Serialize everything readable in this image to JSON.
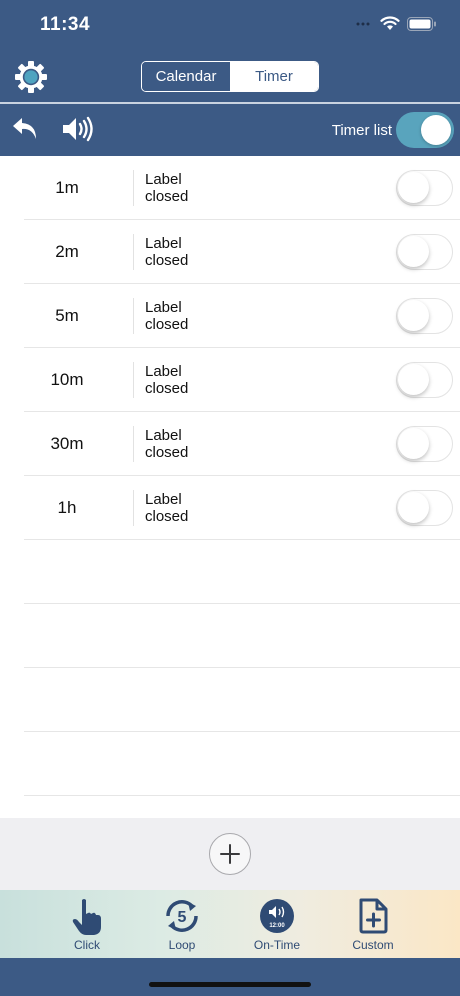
{
  "status_bar": {
    "time": "11:34"
  },
  "header": {
    "segments": [
      {
        "label": "Calendar",
        "selected": false
      },
      {
        "label": "Timer",
        "selected": true
      }
    ]
  },
  "toolbar": {
    "timer_list_label": "Timer list",
    "timer_list_enabled": true
  },
  "timers": [
    {
      "duration": "1m",
      "label_line1": "Label",
      "label_line2": "closed",
      "enabled": false
    },
    {
      "duration": "2m",
      "label_line1": "Label",
      "label_line2": "closed",
      "enabled": false
    },
    {
      "duration": "5m",
      "label_line1": "Label",
      "label_line2": "closed",
      "enabled": false
    },
    {
      "duration": "10m",
      "label_line1": "Label",
      "label_line2": "closed",
      "enabled": false
    },
    {
      "duration": "30m",
      "label_line1": "Label",
      "label_line2": "closed",
      "enabled": false
    },
    {
      "duration": "1h",
      "label_line1": "Label",
      "label_line2": "closed",
      "enabled": false
    }
  ],
  "tabbar": {
    "items": [
      {
        "label": "Click",
        "icon": "hand-pointer-icon"
      },
      {
        "label": "Loop",
        "icon": "loop-5-icon",
        "badge": "5"
      },
      {
        "label": "On-Time",
        "icon": "speaker-clock-icon",
        "badge": "12:00"
      },
      {
        "label": "Custom",
        "icon": "document-plus-icon"
      }
    ]
  },
  "colors": {
    "nav_bg": "#3c5a85",
    "toggle_on": "#59a4bd",
    "tab_text": "#2f4b74"
  }
}
